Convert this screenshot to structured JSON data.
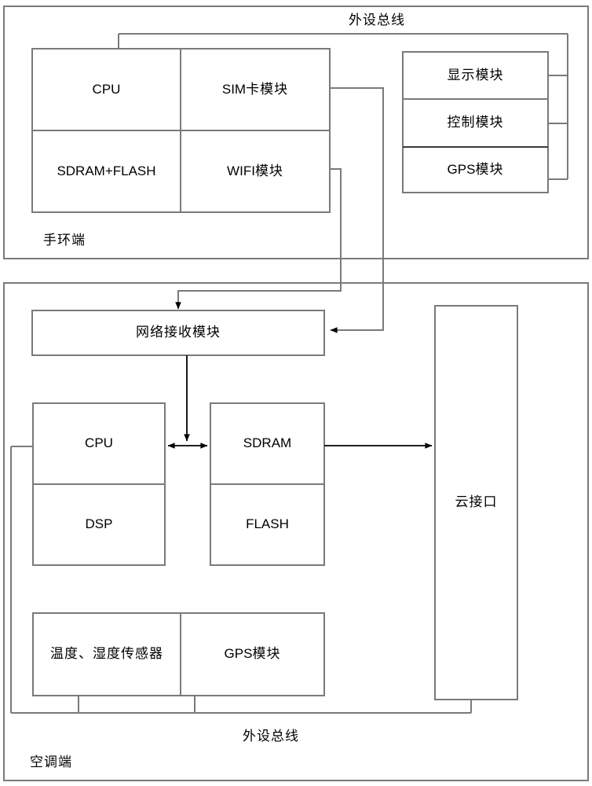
{
  "diagram": {
    "title_bus_top": "外设总线",
    "title_bus_bottom": "外设总线",
    "panels": [
      {
        "id": "wristband",
        "label": "手环端"
      },
      {
        "id": "aircon",
        "label": "空调端"
      }
    ],
    "wristband": {
      "panel_label": "手环端",
      "bus_label": "外设总线",
      "core_grid": [
        {
          "label": "CPU",
          "style": "en"
        },
        {
          "label": "SIM卡模块",
          "style": "mix"
        },
        {
          "label": "SDRAM+FLASH",
          "style": "en"
        },
        {
          "label": "WIFI模块",
          "style": "mix"
        }
      ],
      "peripheral_stack": [
        {
          "label": "显示模块",
          "style": "cn"
        },
        {
          "label": "控制模块",
          "style": "cn"
        },
        {
          "label": "GPS模块",
          "style": "mix"
        }
      ]
    },
    "aircon": {
      "panel_label": "空调端",
      "bus_label": "外设总线",
      "network_module": {
        "label": "网络接收模块",
        "style": "cn"
      },
      "processor_block": [
        {
          "label": "CPU",
          "style": "en"
        },
        {
          "label": "DSP",
          "style": "en"
        }
      ],
      "memory_block": [
        {
          "label": "SDRAM",
          "style": "en"
        },
        {
          "label": "FLASH",
          "style": "en"
        }
      ],
      "sensor_row": [
        {
          "label": "温度、湿度传感器",
          "style": "cn"
        },
        {
          "label": "GPS模块",
          "style": "mix"
        }
      ],
      "cloud_interface": {
        "label": "云接口",
        "style": "cn"
      }
    },
    "colors": {
      "line": "#7a7a7a",
      "line_dark": "#3a3a3a",
      "arrow": "#000000",
      "text": "#000000",
      "background": "#ffffff"
    }
  }
}
